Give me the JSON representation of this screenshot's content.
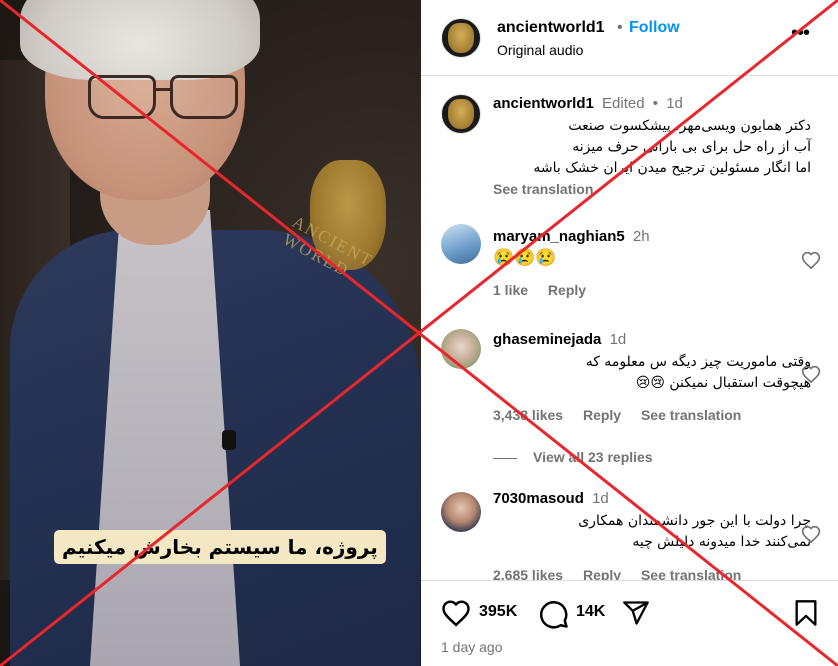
{
  "video": {
    "caption": "پروژه، ما سیستم بخارش میکنیم",
    "watermark_text": "ANCIENT WORLD"
  },
  "header": {
    "username": "ancientworld1",
    "separator": "•",
    "follow_label": "Follow",
    "audio_label": "Original audio",
    "more_icon": "more-horizontal-icon"
  },
  "caption_post": {
    "username": "ancientworld1",
    "edited": "Edited",
    "separator": "•",
    "time": "1d",
    "lines": [
      "دکتر همایون ویسی‌مهر، پیشکسوت صنعت",
      "آب از راه حل برای بی بارانی حرف میزنه",
      "اما انگار مسئولین ترجیح میدن ایران خشک باشه"
    ],
    "see_translation": "See translation"
  },
  "comments": [
    {
      "username": "maryam_naghian5",
      "time": "2h",
      "text": "😢😢😢",
      "likes": "1 like",
      "reply": "Reply"
    },
    {
      "username": "ghaseminejada",
      "time": "1d",
      "lines": [
        "وقتی ماموریت چیز دیگه س معلومه که",
        "هیچوقت استقبال نمیکنن 😢😢"
      ],
      "likes": "3,438 likes",
      "reply": "Reply",
      "see_translation": "See translation",
      "view_replies": "View all 23 replies"
    },
    {
      "username": "7030masoud",
      "time": "1d",
      "lines": [
        "چرا دولت با این جور دانشمندان همکاری",
        "نمی‌کنند خدا میدونه دلیلش چیه"
      ],
      "likes": "2,685 likes",
      "reply": "Reply",
      "see_translation": "See translation"
    }
  ],
  "actions": {
    "likes_count": "395K",
    "comments_count": "14K",
    "posted": "1 day ago"
  },
  "colors": {
    "follow": "#0095f6",
    "muted": "#737373",
    "cross": "#e8262b"
  }
}
